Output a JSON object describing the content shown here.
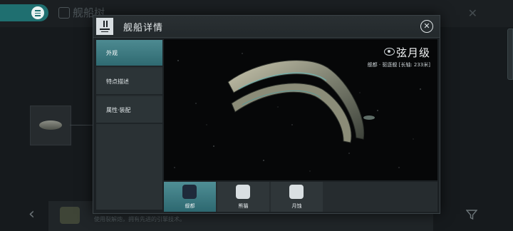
{
  "background": {
    "page_title": "舰船树",
    "bottom_hint": "使用裂解炮，拥有先进的引擎技术。"
  },
  "dialog": {
    "title": "舰船详情",
    "sidebar": {
      "items": [
        {
          "label": "外观",
          "active": true
        },
        {
          "label": "特点描述",
          "active": false
        },
        {
          "label": "属性·装配",
          "active": false
        }
      ]
    },
    "viewer": {
      "ship_name": "弦月级",
      "ship_info": "舰都 · 驱逐舰 [长轴: 233米]"
    },
    "variant_tabs": [
      {
        "label": "舰都",
        "active": true
      },
      {
        "label": "熊猫",
        "active": false
      },
      {
        "label": "月蚀",
        "active": false
      }
    ]
  },
  "colors": {
    "accent": "#2f6a71",
    "menu_button": "#1f6f70"
  }
}
